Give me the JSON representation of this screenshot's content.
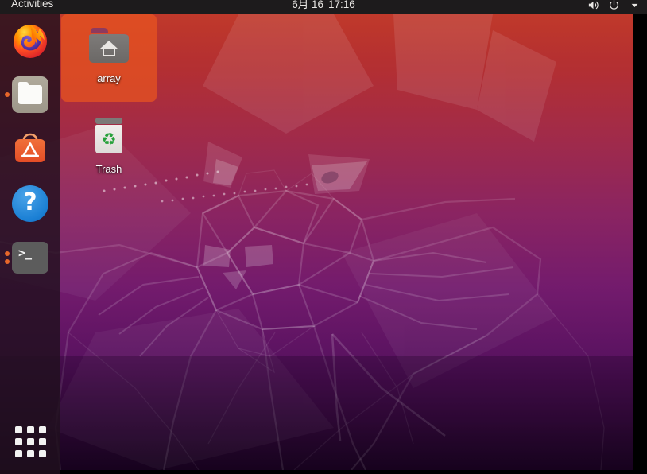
{
  "desktop": {
    "environment": "GNOME Shell on Ubuntu",
    "wallpaper_name": "Ubuntu Focal Fossa geometric wallpaper",
    "colors": {
      "top_bar": "#1d1b1c",
      "dock": "rgba(32,16,29,0.82)",
      "wallpaper_top": "#c0392b",
      "wallpaper_bottom": "#190420",
      "accent_orange": "#e8672a",
      "selection": "rgba(233,84,32,0.72)",
      "border_black": "#000000"
    }
  },
  "top_bar": {
    "activities_label": "Activities",
    "clock": {
      "date": "6月 16",
      "time": "17:16"
    },
    "status_icons": [
      {
        "name": "volume-icon",
        "glyph": "🔊"
      },
      {
        "name": "power-icon",
        "glyph": "⏻"
      },
      {
        "name": "chevron-down-icon",
        "glyph": "▾"
      }
    ]
  },
  "dock": {
    "items": [
      {
        "name": "firefox",
        "label": "Firefox Web Browser",
        "icon": "firefox-icon",
        "running_indicators": 0
      },
      {
        "name": "files",
        "label": "Files",
        "icon": "files-icon",
        "running_indicators": 1
      },
      {
        "name": "ubuntu-software",
        "label": "Ubuntu Software",
        "icon": "ubuntu-software-icon",
        "running_indicators": 0
      },
      {
        "name": "help",
        "label": "Help",
        "icon": "help-icon",
        "glyph": "?",
        "running_indicators": 0
      },
      {
        "name": "terminal",
        "label": "Terminal",
        "icon": "terminal-icon",
        "glyph": ">_",
        "running_indicators": 2
      }
    ],
    "show_applications_label": "Show Applications"
  },
  "desktop_icons": [
    {
      "name": "array",
      "label": "array",
      "icon": "home-folder-icon",
      "selected": true
    },
    {
      "name": "trash",
      "label": "Trash",
      "icon": "trash-icon",
      "selected": false
    }
  ]
}
